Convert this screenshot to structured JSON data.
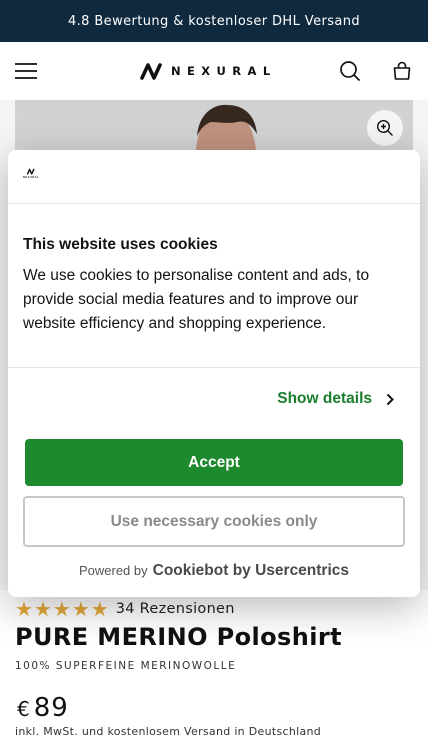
{
  "announcement": {
    "text": "4.8 Bewertung & kostenloser DHL Versand"
  },
  "header": {
    "brand": "NEXURAL",
    "icons": [
      "menu-icon",
      "search-icon",
      "bag-icon"
    ]
  },
  "hero": {
    "zoom_icon": "zoom-in-icon"
  },
  "cookie_dialog": {
    "logo_text": "NEXURAL",
    "title": "This website uses cookies",
    "body": "We use cookies to personalise content and ads, to provide social media features and  to improve our website efficiency and shopping experience.",
    "details_label": "Show details",
    "accept_label": "Accept",
    "necessary_label": "Use necessary cookies only",
    "powered_prefix": "Powered by",
    "powered_brand": "Cookiebot by Usercentrics",
    "accent_color": "#1e8a2e"
  },
  "product": {
    "rating_stars": 5,
    "reviews": "34 Rezensionen",
    "title": "PURE MERINO Poloshirt",
    "subtitle": "100% SUPERFEINE MERINOWOLLE",
    "currency": "€",
    "price": "89",
    "tax_note": "inkl. MwSt. und kostenlosem Versand in Deutschland",
    "star_color": "#e5a93a"
  }
}
